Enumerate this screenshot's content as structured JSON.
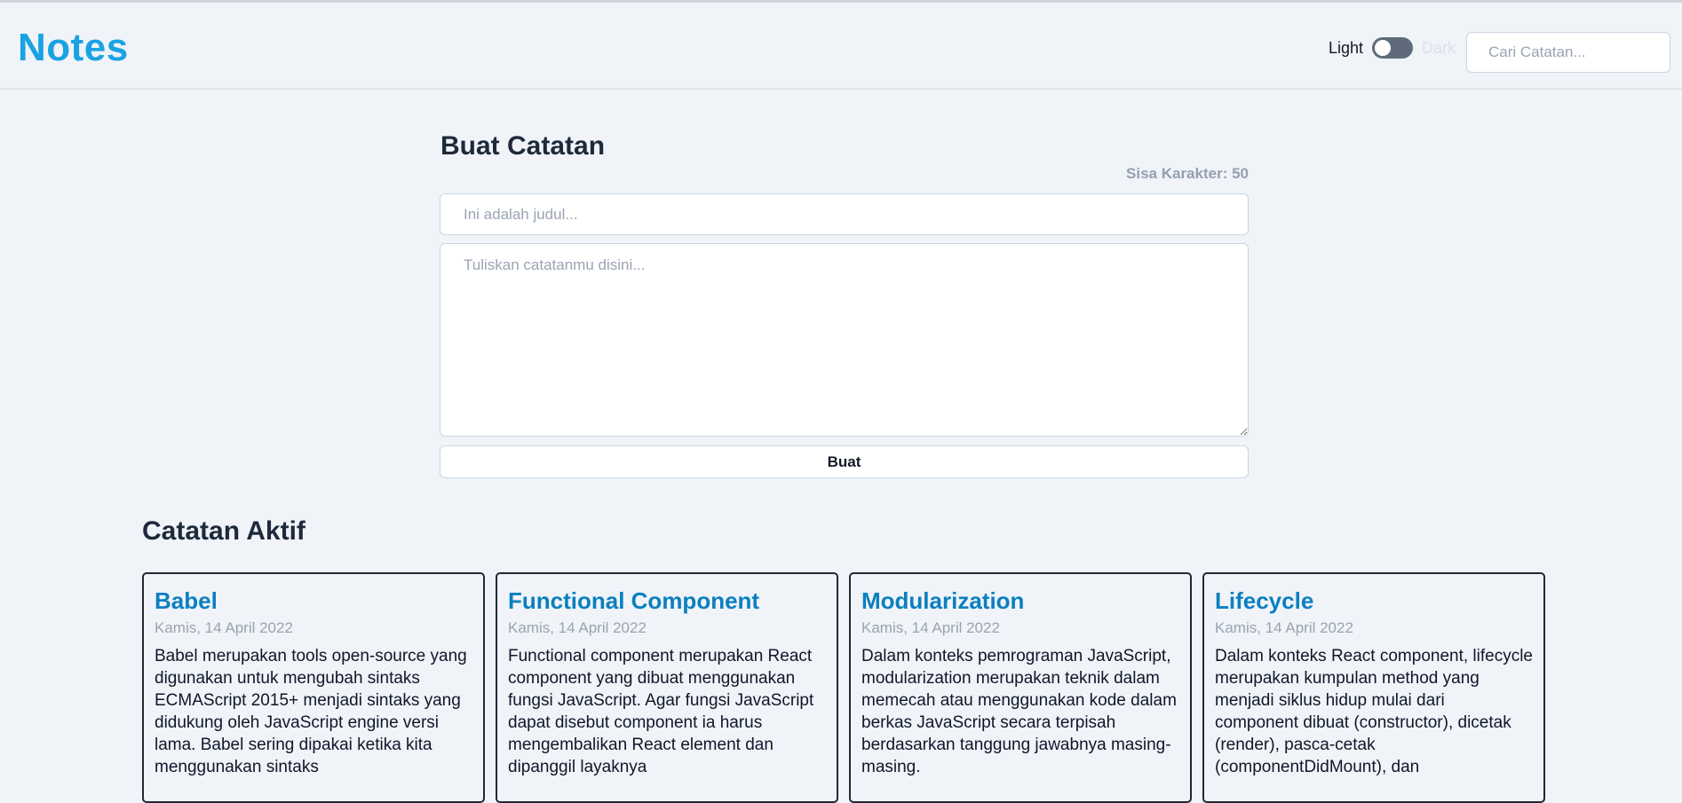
{
  "header": {
    "brand": "Notes",
    "theme": {
      "light_label": "Light",
      "dark_label": "Dark",
      "mode": "light"
    },
    "search": {
      "placeholder": "Cari Catatan...",
      "value": ""
    }
  },
  "form": {
    "title": "Buat Catatan",
    "char_left": "Sisa Karakter: 50",
    "title_placeholder": "Ini adalah judul...",
    "body_placeholder": "Tuliskan catatanmu disini...",
    "submit_label": "Buat"
  },
  "active": {
    "title": "Catatan Aktif",
    "notes": [
      {
        "title": "Babel",
        "date": "Kamis, 14 April 2022",
        "body": "Babel merupakan tools open-source yang digunakan untuk mengubah sintaks ECMAScript 2015+ menjadi sintaks yang didukung oleh JavaScript engine versi lama. Babel sering dipakai ketika kita menggunakan sintaks"
      },
      {
        "title": "Functional Component",
        "date": "Kamis, 14 April 2022",
        "body": "Functional component merupakan React component yang dibuat menggunakan fungsi JavaScript. Agar fungsi JavaScript dapat disebut component ia harus mengembalikan React element dan dipanggil layaknya"
      },
      {
        "title": "Modularization",
        "date": "Kamis, 14 April 2022",
        "body": "Dalam konteks pemrograman JavaScript, modularization merupakan teknik dalam memecah atau menggunakan kode dalam berkas JavaScript secara terpisah berdasarkan tanggung jawabnya masing-masing."
      },
      {
        "title": "Lifecycle",
        "date": "Kamis, 14 April 2022",
        "body": "Dalam konteks React component, lifecycle merupakan kumpulan method yang menjadi siklus hidup mulai dari component dibuat (constructor), dicetak (render), pasca-cetak (componentDidMount), dan"
      }
    ]
  },
  "colors": {
    "accent": "#1aa3e2",
    "note_title": "#0b7fc0",
    "background": "#f0f3f8"
  }
}
